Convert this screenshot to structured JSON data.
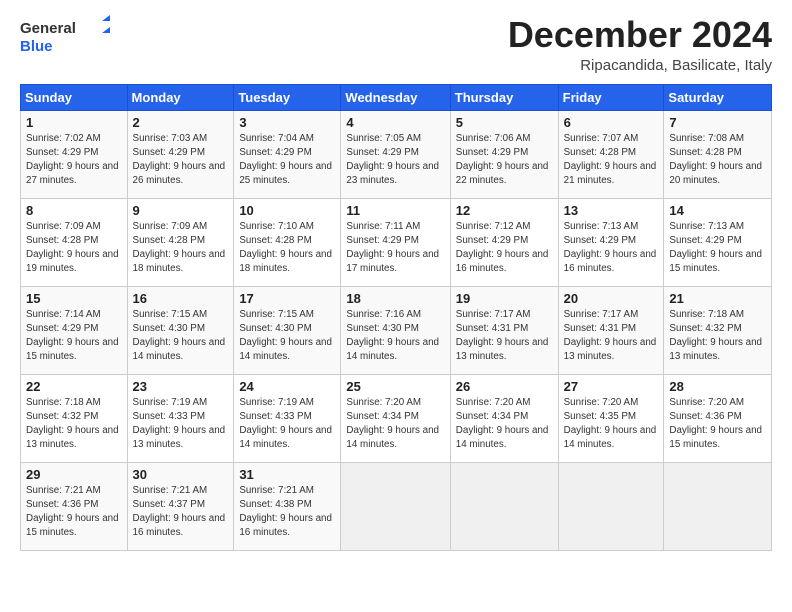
{
  "header": {
    "logo_general": "General",
    "logo_blue": "Blue",
    "month_title": "December 2024",
    "subtitle": "Ripacandida, Basilicate, Italy"
  },
  "days_of_week": [
    "Sunday",
    "Monday",
    "Tuesday",
    "Wednesday",
    "Thursday",
    "Friday",
    "Saturday"
  ],
  "weeks": [
    [
      {
        "day": "1",
        "sunrise": "7:02 AM",
        "sunset": "4:29 PM",
        "daylight": "9 hours and 27 minutes."
      },
      {
        "day": "2",
        "sunrise": "7:03 AM",
        "sunset": "4:29 PM",
        "daylight": "9 hours and 26 minutes."
      },
      {
        "day": "3",
        "sunrise": "7:04 AM",
        "sunset": "4:29 PM",
        "daylight": "9 hours and 25 minutes."
      },
      {
        "day": "4",
        "sunrise": "7:05 AM",
        "sunset": "4:29 PM",
        "daylight": "9 hours and 23 minutes."
      },
      {
        "day": "5",
        "sunrise": "7:06 AM",
        "sunset": "4:29 PM",
        "daylight": "9 hours and 22 minutes."
      },
      {
        "day": "6",
        "sunrise": "7:07 AM",
        "sunset": "4:28 PM",
        "daylight": "9 hours and 21 minutes."
      },
      {
        "day": "7",
        "sunrise": "7:08 AM",
        "sunset": "4:28 PM",
        "daylight": "9 hours and 20 minutes."
      }
    ],
    [
      {
        "day": "8",
        "sunrise": "7:09 AM",
        "sunset": "4:28 PM",
        "daylight": "9 hours and 19 minutes."
      },
      {
        "day": "9",
        "sunrise": "7:09 AM",
        "sunset": "4:28 PM",
        "daylight": "9 hours and 18 minutes."
      },
      {
        "day": "10",
        "sunrise": "7:10 AM",
        "sunset": "4:28 PM",
        "daylight": "9 hours and 18 minutes."
      },
      {
        "day": "11",
        "sunrise": "7:11 AM",
        "sunset": "4:29 PM",
        "daylight": "9 hours and 17 minutes."
      },
      {
        "day": "12",
        "sunrise": "7:12 AM",
        "sunset": "4:29 PM",
        "daylight": "9 hours and 16 minutes."
      },
      {
        "day": "13",
        "sunrise": "7:13 AM",
        "sunset": "4:29 PM",
        "daylight": "9 hours and 16 minutes."
      },
      {
        "day": "14",
        "sunrise": "7:13 AM",
        "sunset": "4:29 PM",
        "daylight": "9 hours and 15 minutes."
      }
    ],
    [
      {
        "day": "15",
        "sunrise": "7:14 AM",
        "sunset": "4:29 PM",
        "daylight": "9 hours and 15 minutes."
      },
      {
        "day": "16",
        "sunrise": "7:15 AM",
        "sunset": "4:30 PM",
        "daylight": "9 hours and 14 minutes."
      },
      {
        "day": "17",
        "sunrise": "7:15 AM",
        "sunset": "4:30 PM",
        "daylight": "9 hours and 14 minutes."
      },
      {
        "day": "18",
        "sunrise": "7:16 AM",
        "sunset": "4:30 PM",
        "daylight": "9 hours and 14 minutes."
      },
      {
        "day": "19",
        "sunrise": "7:17 AM",
        "sunset": "4:31 PM",
        "daylight": "9 hours and 13 minutes."
      },
      {
        "day": "20",
        "sunrise": "7:17 AM",
        "sunset": "4:31 PM",
        "daylight": "9 hours and 13 minutes."
      },
      {
        "day": "21",
        "sunrise": "7:18 AM",
        "sunset": "4:32 PM",
        "daylight": "9 hours and 13 minutes."
      }
    ],
    [
      {
        "day": "22",
        "sunrise": "7:18 AM",
        "sunset": "4:32 PM",
        "daylight": "9 hours and 13 minutes."
      },
      {
        "day": "23",
        "sunrise": "7:19 AM",
        "sunset": "4:33 PM",
        "daylight": "9 hours and 13 minutes."
      },
      {
        "day": "24",
        "sunrise": "7:19 AM",
        "sunset": "4:33 PM",
        "daylight": "9 hours and 14 minutes."
      },
      {
        "day": "25",
        "sunrise": "7:20 AM",
        "sunset": "4:34 PM",
        "daylight": "9 hours and 14 minutes."
      },
      {
        "day": "26",
        "sunrise": "7:20 AM",
        "sunset": "4:34 PM",
        "daylight": "9 hours and 14 minutes."
      },
      {
        "day": "27",
        "sunrise": "7:20 AM",
        "sunset": "4:35 PM",
        "daylight": "9 hours and 14 minutes."
      },
      {
        "day": "28",
        "sunrise": "7:20 AM",
        "sunset": "4:36 PM",
        "daylight": "9 hours and 15 minutes."
      }
    ],
    [
      {
        "day": "29",
        "sunrise": "7:21 AM",
        "sunset": "4:36 PM",
        "daylight": "9 hours and 15 minutes."
      },
      {
        "day": "30",
        "sunrise": "7:21 AM",
        "sunset": "4:37 PM",
        "daylight": "9 hours and 16 minutes."
      },
      {
        "day": "31",
        "sunrise": "7:21 AM",
        "sunset": "4:38 PM",
        "daylight": "9 hours and 16 minutes."
      },
      null,
      null,
      null,
      null
    ]
  ],
  "labels": {
    "sunrise": "Sunrise:",
    "sunset": "Sunset:",
    "daylight": "Daylight:"
  }
}
